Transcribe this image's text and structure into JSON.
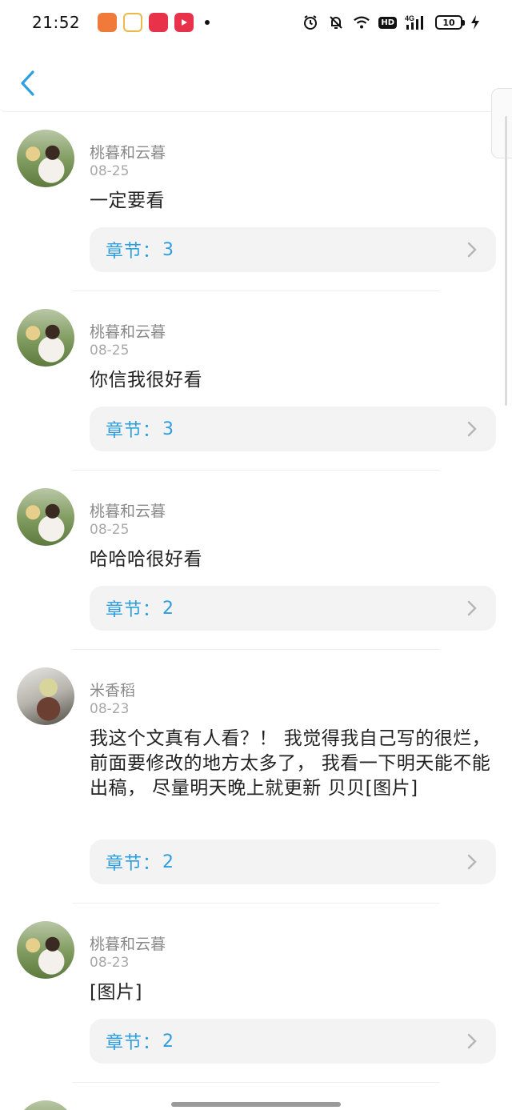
{
  "status_bar": {
    "time": "21:52",
    "battery": "10",
    "network": "4G",
    "hd": "HD"
  },
  "header": {
    "back_icon": "chevron-left-icon"
  },
  "comments": [
    {
      "user": "桃暮和云暮",
      "date": "08-25",
      "text": "一定要看",
      "chapter_label": "章节：",
      "chapter": "3",
      "avatar": "girl"
    },
    {
      "user": "桃暮和云暮",
      "date": "08-25",
      "text": "你信我很好看",
      "chapter_label": "章节：",
      "chapter": "3",
      "avatar": "girl"
    },
    {
      "user": "桃暮和云暮",
      "date": "08-25",
      "text": "哈哈哈很好看",
      "chapter_label": "章节：",
      "chapter": "2",
      "avatar": "girl"
    },
    {
      "user": "米香稻",
      "date": "08-23",
      "text": "我这个文真有人看？！ 我觉得我自己写的很烂， 前面要修改的地方太多了， 我看一下明天能不能出稿， 尽量明天晚上就更新 贝贝[图片]",
      "chapter_label": "章节：",
      "chapter": "2",
      "avatar": "anime"
    },
    {
      "user": "桃暮和云暮",
      "date": "08-23",
      "text": "[图片]",
      "chapter_label": "章节：",
      "chapter": "2",
      "avatar": "girl"
    }
  ],
  "colors": {
    "accent": "#2d9fe0",
    "username": "#8a8a8a",
    "date": "#a8a8a8",
    "chapter_bg": "#f3f3f3"
  }
}
